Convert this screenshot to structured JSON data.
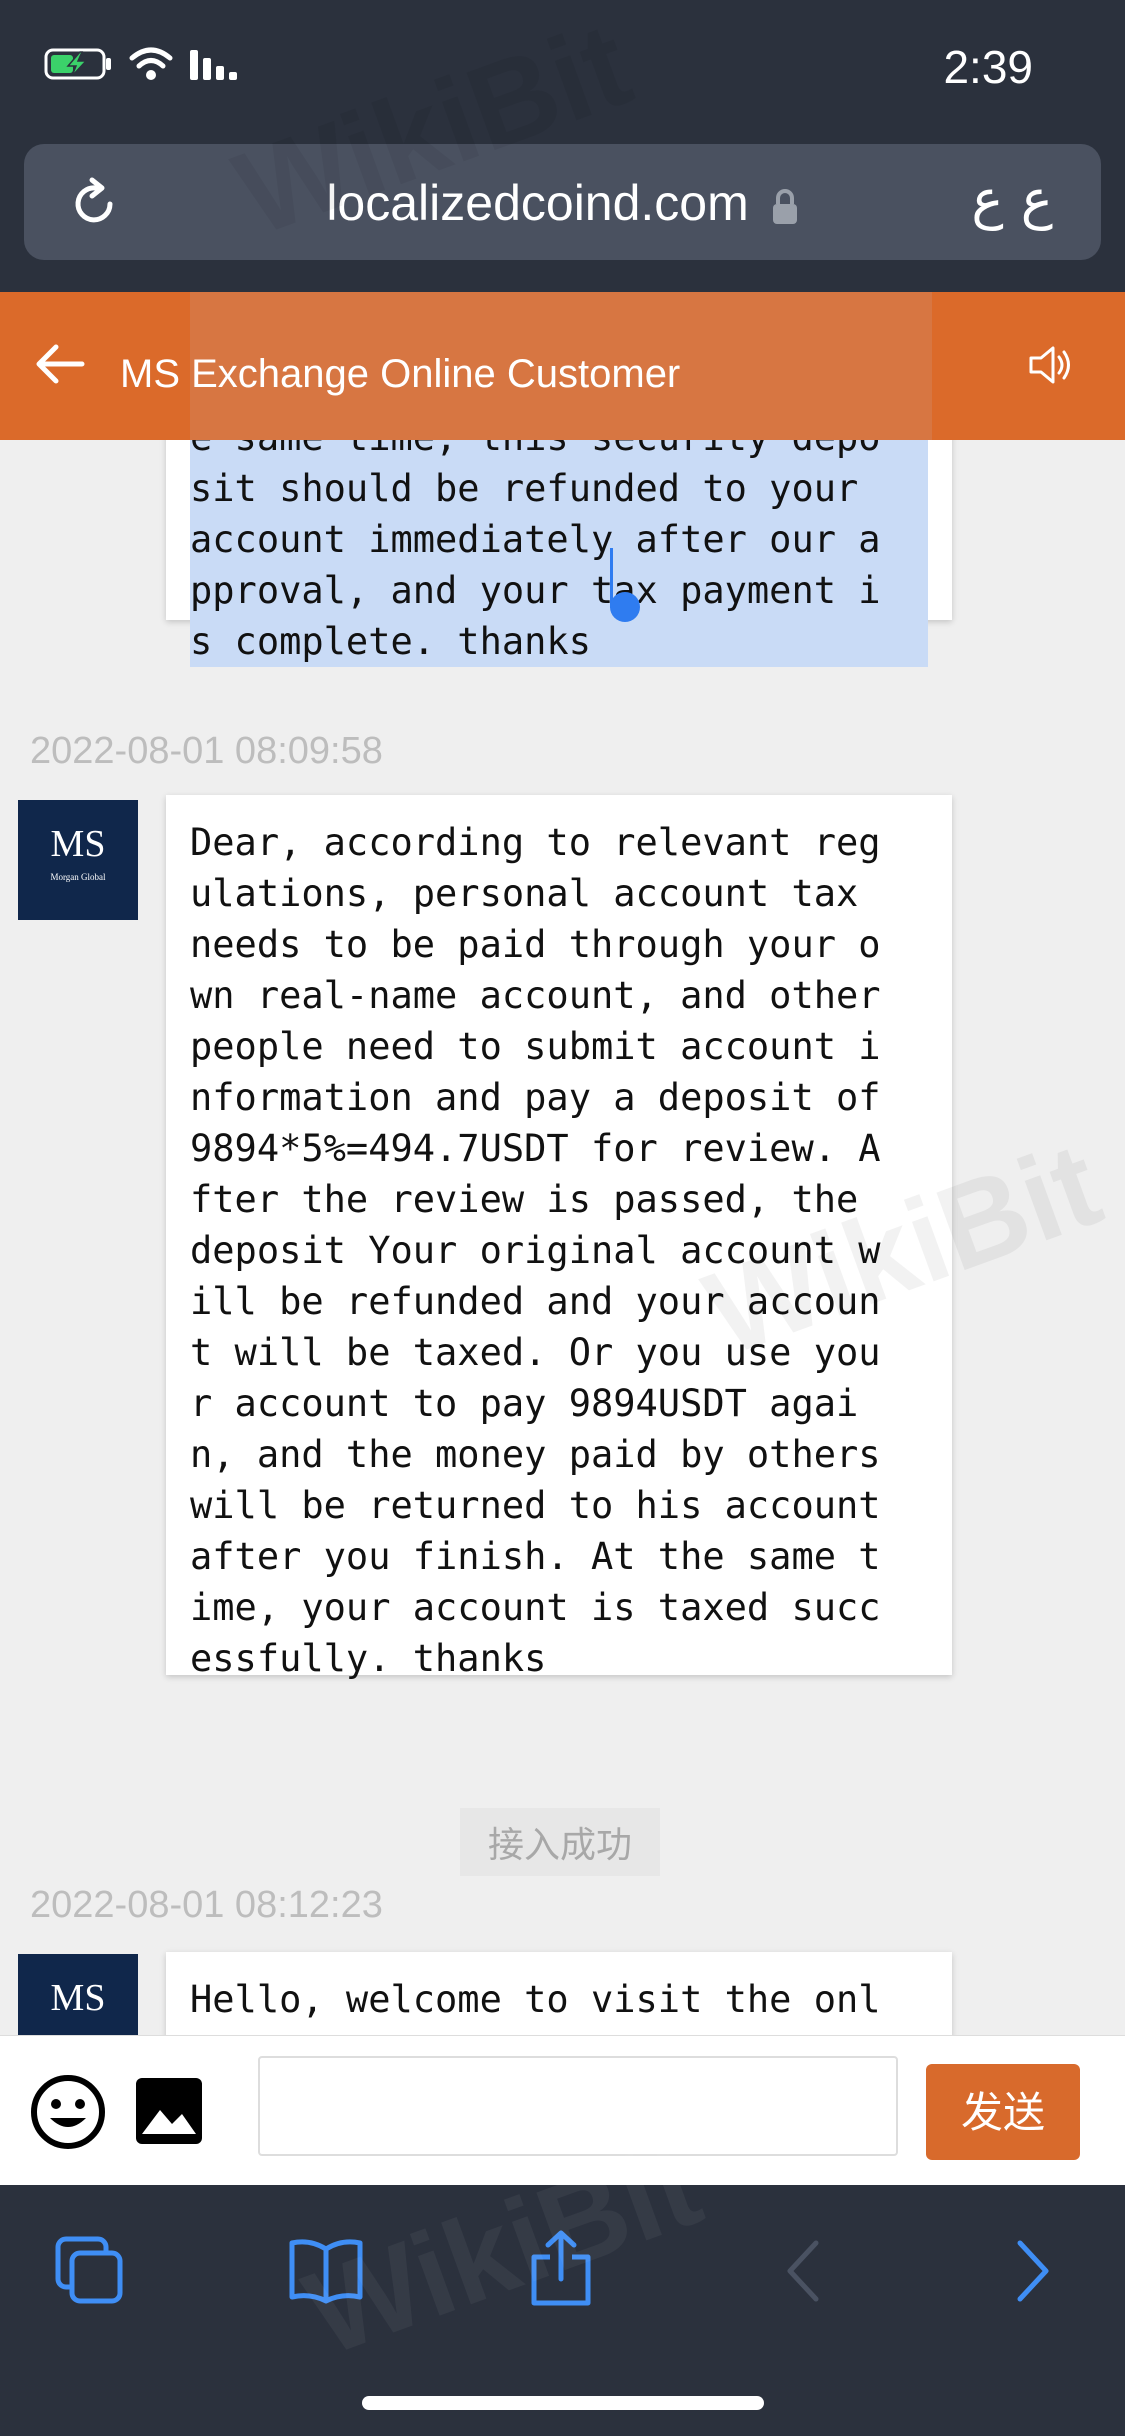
{
  "status_bar": {
    "time": "2:39"
  },
  "browser": {
    "url": "localizedcoind.com",
    "page_language_label": "ع ع"
  },
  "chat_header": {
    "title": "MS Exchange Online Customer"
  },
  "messages": [
    {
      "text": "e same time, this security depo\nsit should be refunded to your\naccount immediately after our a\npproval, and your tax payment i\ns complete. thanks",
      "selected": true
    },
    {
      "timestamp": "2022-08-01 08:09:58",
      "avatar": {
        "initials": "MS",
        "caption": "Morgan Global"
      },
      "text": "Dear, according to relevant reg\nulations, personal account tax\nneeds to be paid through your o\nwn real-name account, and other\npeople need to submit account i\nnformation and pay a deposit of\n9894*5%=494.7USDT for review. A\nfter the review is passed, the\ndeposit Your original account w\nill be refunded and your accoun\nt will be taxed. Or you use you\nr account to pay 9894USDT agai\nn, and the money paid by others\nwill be returned to his account\nafter you finish. At the same t\nime, your account is taxed succ\nessfully. thanks"
    },
    {
      "system_text": "接入成功"
    },
    {
      "timestamp": "2022-08-01 08:12:23",
      "avatar": {
        "initials": "MS"
      },
      "text": "Hello, welcome to visit the onl"
    }
  ],
  "input_bar": {
    "send_label": "发送",
    "input_value": ""
  },
  "watermark": "WikiBit",
  "colors": {
    "accent": "#db6a2a",
    "chrome": "#2b313d",
    "chat_bg": "#efefef",
    "selection": "#c9dbf6",
    "link_blue": "#2f7cf0"
  },
  "icons": [
    "battery-charging-icon",
    "wifi-icon",
    "signal-icon",
    "reload-icon",
    "lock-icon",
    "back-arrow-icon",
    "speaker-icon",
    "emoji-icon",
    "image-icon",
    "tabs-icon",
    "bookmarks-icon",
    "share-icon",
    "back-nav-icon",
    "forward-nav-icon"
  ]
}
